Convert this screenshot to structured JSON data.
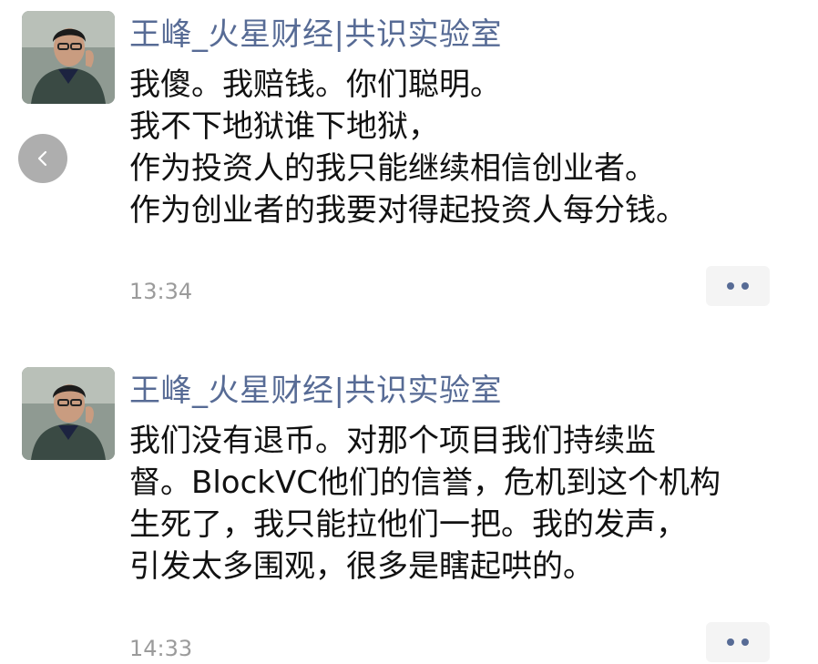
{
  "posts": [
    {
      "author": "王峰_火星财经|共识实验室",
      "lines": [
        "我傻。我赔钱。你们聪明。",
        "我不下地狱谁下地狱，",
        "作为投资人的我只能继续相信创业者。",
        "作为创业者的我要对得起投资人每分钱。"
      ],
      "time": "13:34"
    },
    {
      "author": "王峰_火星财经|共识实验室",
      "lines": [
        "我们没有退币。对那个项目我们持续监",
        "督。BlockVC他们的信誉，危机到这个机构",
        "生死了，我只能拉他们一把。我的发声，",
        "引发太多围观，很多是瞎起哄的。"
      ],
      "time": "14:33"
    }
  ],
  "icons": {
    "back": "chevron-left-icon",
    "more": "more-dots-icon"
  },
  "colors": {
    "author_name": "#576b95",
    "timestamp": "#9b9b9b",
    "more_button_bg": "#f4f4f4"
  }
}
